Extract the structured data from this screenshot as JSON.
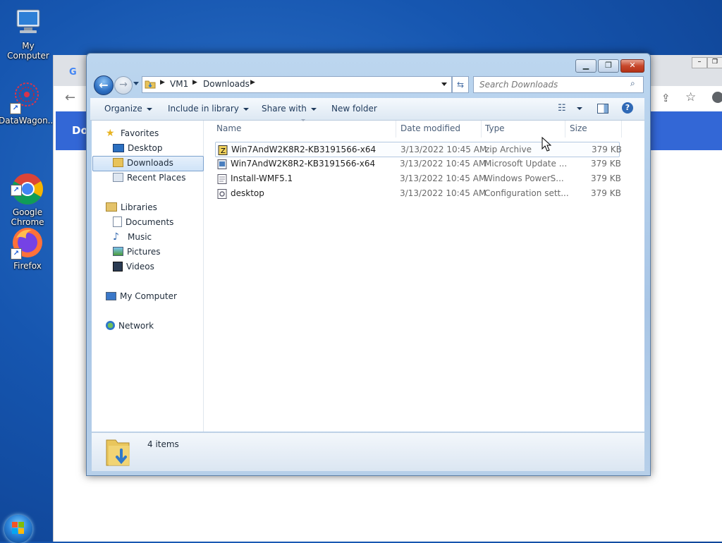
{
  "desktop": {
    "icons": [
      {
        "label": "My Computer"
      },
      {
        "label": "DataWagon..."
      },
      {
        "label": "Google\nChrome"
      },
      {
        "label": "Firefox"
      }
    ]
  },
  "browser": {
    "tab_logo": "G",
    "bluebar_text": "Do"
  },
  "explorer": {
    "address": {
      "crumbs": [
        "VM1",
        "Downloads"
      ]
    },
    "search": {
      "placeholder": "Search Downloads"
    },
    "commands": {
      "organize": "Organize",
      "include_in_library": "Include in library",
      "share_with": "Share with",
      "new_folder": "New folder"
    },
    "nav": {
      "favorites": "Favorites",
      "desktop": "Desktop",
      "downloads": "Downloads",
      "recent_places": "Recent Places",
      "libraries": "Libraries",
      "documents": "Documents",
      "music": "Music",
      "pictures": "Pictures",
      "videos": "Videos",
      "my_computer": "My Computer",
      "network": "Network"
    },
    "columns": {
      "name": "Name",
      "date_modified": "Date modified",
      "type": "Type",
      "size": "Size"
    },
    "files": [
      {
        "name": "Win7AndW2K8R2-KB3191566-x64",
        "date": "3/13/2022 10:45 AM",
        "type": "zip Archive",
        "size": "379 KB",
        "icon": "zip-icon"
      },
      {
        "name": "Win7AndW2K8R2-KB3191566-x64",
        "date": "3/13/2022 10:45 AM",
        "type": "Microsoft Update ...",
        "size": "379 KB",
        "icon": "msu-icon"
      },
      {
        "name": "Install-WMF5.1",
        "date": "3/13/2022 10:45 AM",
        "type": "Windows PowerS...",
        "size": "379 KB",
        "icon": "powershell-script-icon"
      },
      {
        "name": "desktop",
        "date": "3/13/2022 10:45 AM",
        "type": "Configuration sett...",
        "size": "379 KB",
        "icon": "config-file-icon"
      }
    ],
    "status": {
      "item_count": "4 items"
    }
  }
}
